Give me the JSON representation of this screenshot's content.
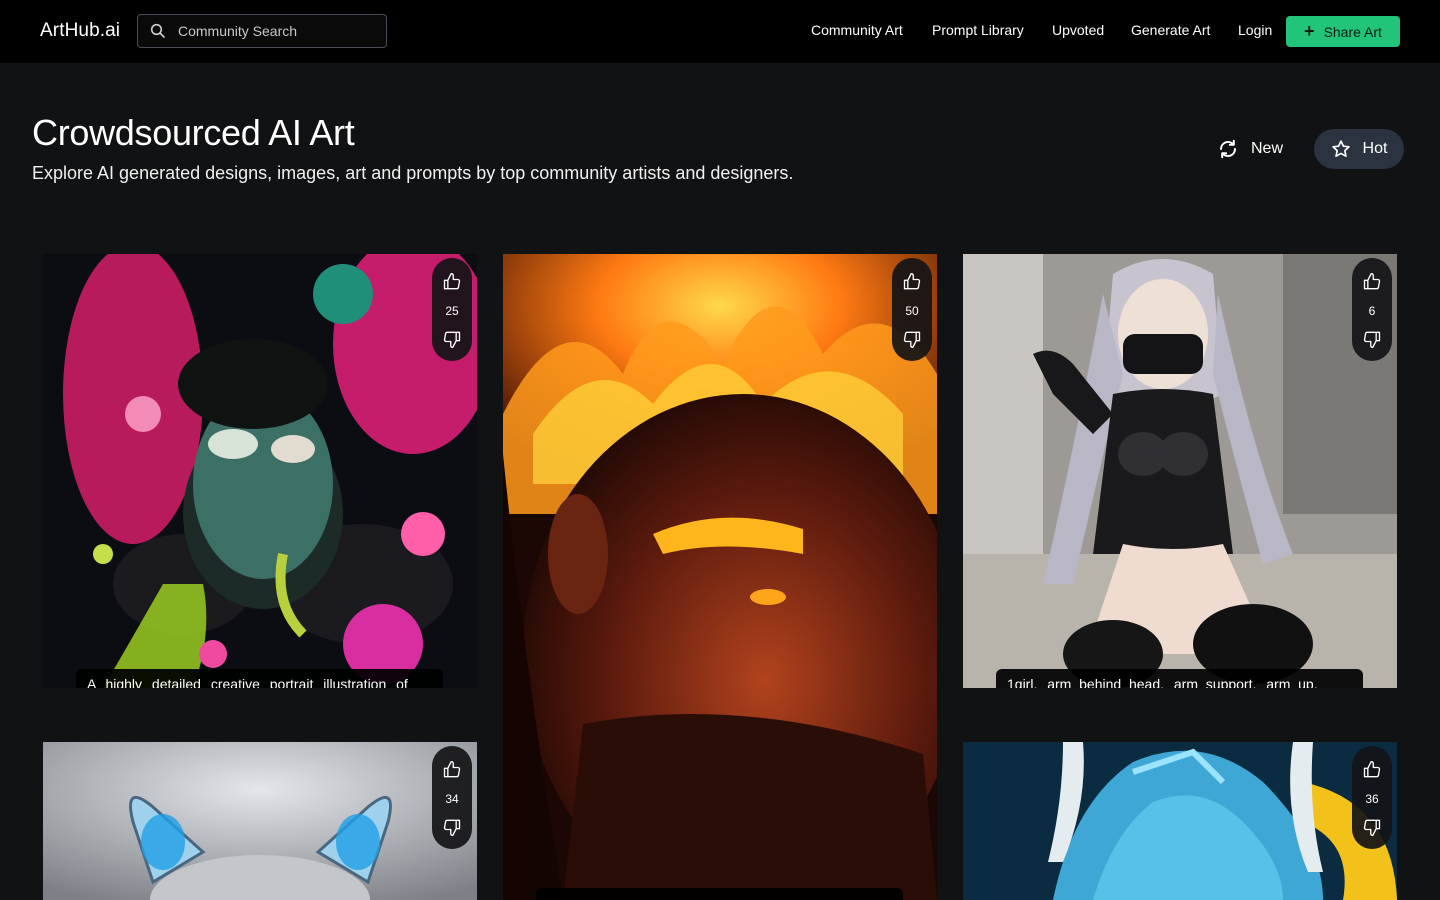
{
  "header": {
    "logo": "ArtHub.ai",
    "search": {
      "placeholder": "Community Search",
      "value": ""
    },
    "nav": [
      "Community Art",
      "Prompt Library",
      "Upvoted",
      "Generate Art",
      "Login"
    ],
    "share_label": "Share Art",
    "accent_color": "#22c47a"
  },
  "hero": {
    "title": "Crowdsourced AI Art",
    "subtitle": "Explore AI generated designs, images, art and prompts by top community artists and designers."
  },
  "sort": {
    "new_label": "New",
    "hot_label": "Hot",
    "active": "Hot"
  },
  "cards": [
    {
      "votes": "25",
      "caption": "A highly detailed creative portrait illustration of",
      "subject": "splatter-paint zombie portrait"
    },
    {
      "votes": "50",
      "caption": "",
      "subject": "fiery bearded warrior"
    },
    {
      "votes": "6",
      "caption": "1girl, arm_behind_head, arm_support, arm_up,",
      "subject": "silver-haired masked anime girl"
    },
    {
      "votes": "34",
      "caption": "",
      "subject": "chrome cat sculpture"
    },
    {
      "votes": "36",
      "caption": "",
      "subject": "blue horned creature"
    }
  ]
}
